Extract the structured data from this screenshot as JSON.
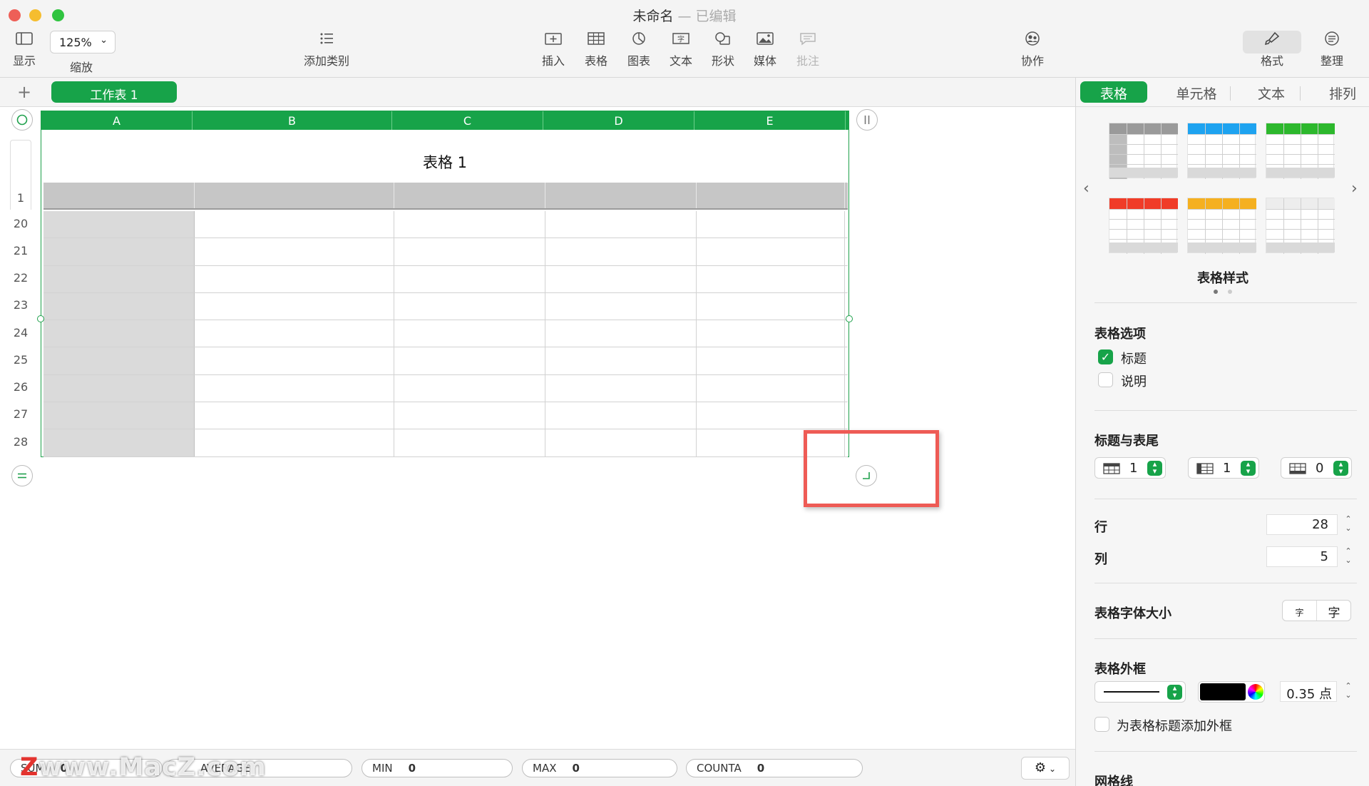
{
  "window": {
    "title": "未命名",
    "edited": "— 已编辑"
  },
  "toolbar": {
    "view_label": "显示",
    "zoom_value": "125%",
    "zoom_label": "缩放",
    "add_category_label": "添加类别",
    "insert_label": "插入",
    "table_label": "表格",
    "chart_label": "图表",
    "text_label": "文本",
    "shape_label": "形状",
    "media_label": "媒体",
    "comment_label": "批注",
    "collaborate_label": "协作",
    "format_label": "格式",
    "organize_label": "整理"
  },
  "sheets": {
    "add": "+",
    "active": "工作表 1"
  },
  "table": {
    "columns": [
      "A",
      "B",
      "C",
      "D",
      "E"
    ],
    "title": "表格 1",
    "row_numbers": [
      "1",
      "20",
      "21",
      "22",
      "23",
      "24",
      "25",
      "26",
      "27",
      "28"
    ]
  },
  "statusbar": {
    "sum_label": "SUM",
    "sum_value": "0",
    "average_label": "AVERAGE",
    "min_label": "MIN",
    "min_value": "0",
    "max_label": "MAX",
    "max_value": "0",
    "counta_label": "COUNTA",
    "counta_value": "0",
    "watermark": "www.MacZ.com",
    "watermark_z": "Z"
  },
  "inspector": {
    "tabs": [
      "表格",
      "单元格",
      "文本",
      "排列"
    ],
    "style_caption": "表格样式",
    "style_colors": [
      "#9a9a9a",
      "#1ea3f0",
      "#2db82d",
      "#f03c28",
      "#f5b020",
      "#ededed"
    ],
    "options_title": "表格选项",
    "opt_title": "标题",
    "opt_title_checked": true,
    "opt_caption": "说明",
    "opt_caption_checked": false,
    "headers_footers_title": "标题与表尾",
    "header_rows": "1",
    "header_cols": "1",
    "footer_rows": "0",
    "rows_label": "行",
    "rows_value": "28",
    "cols_label": "列",
    "cols_value": "5",
    "font_size_title": "表格字体大小",
    "font_small": "字",
    "font_large": "字",
    "outline_title": "表格外框",
    "outline_color": "#000000",
    "outline_width": "0.35 点",
    "outline_header": "为表格标题添加外框",
    "gridlines_title": "网格线",
    "accent": "#17a349"
  }
}
